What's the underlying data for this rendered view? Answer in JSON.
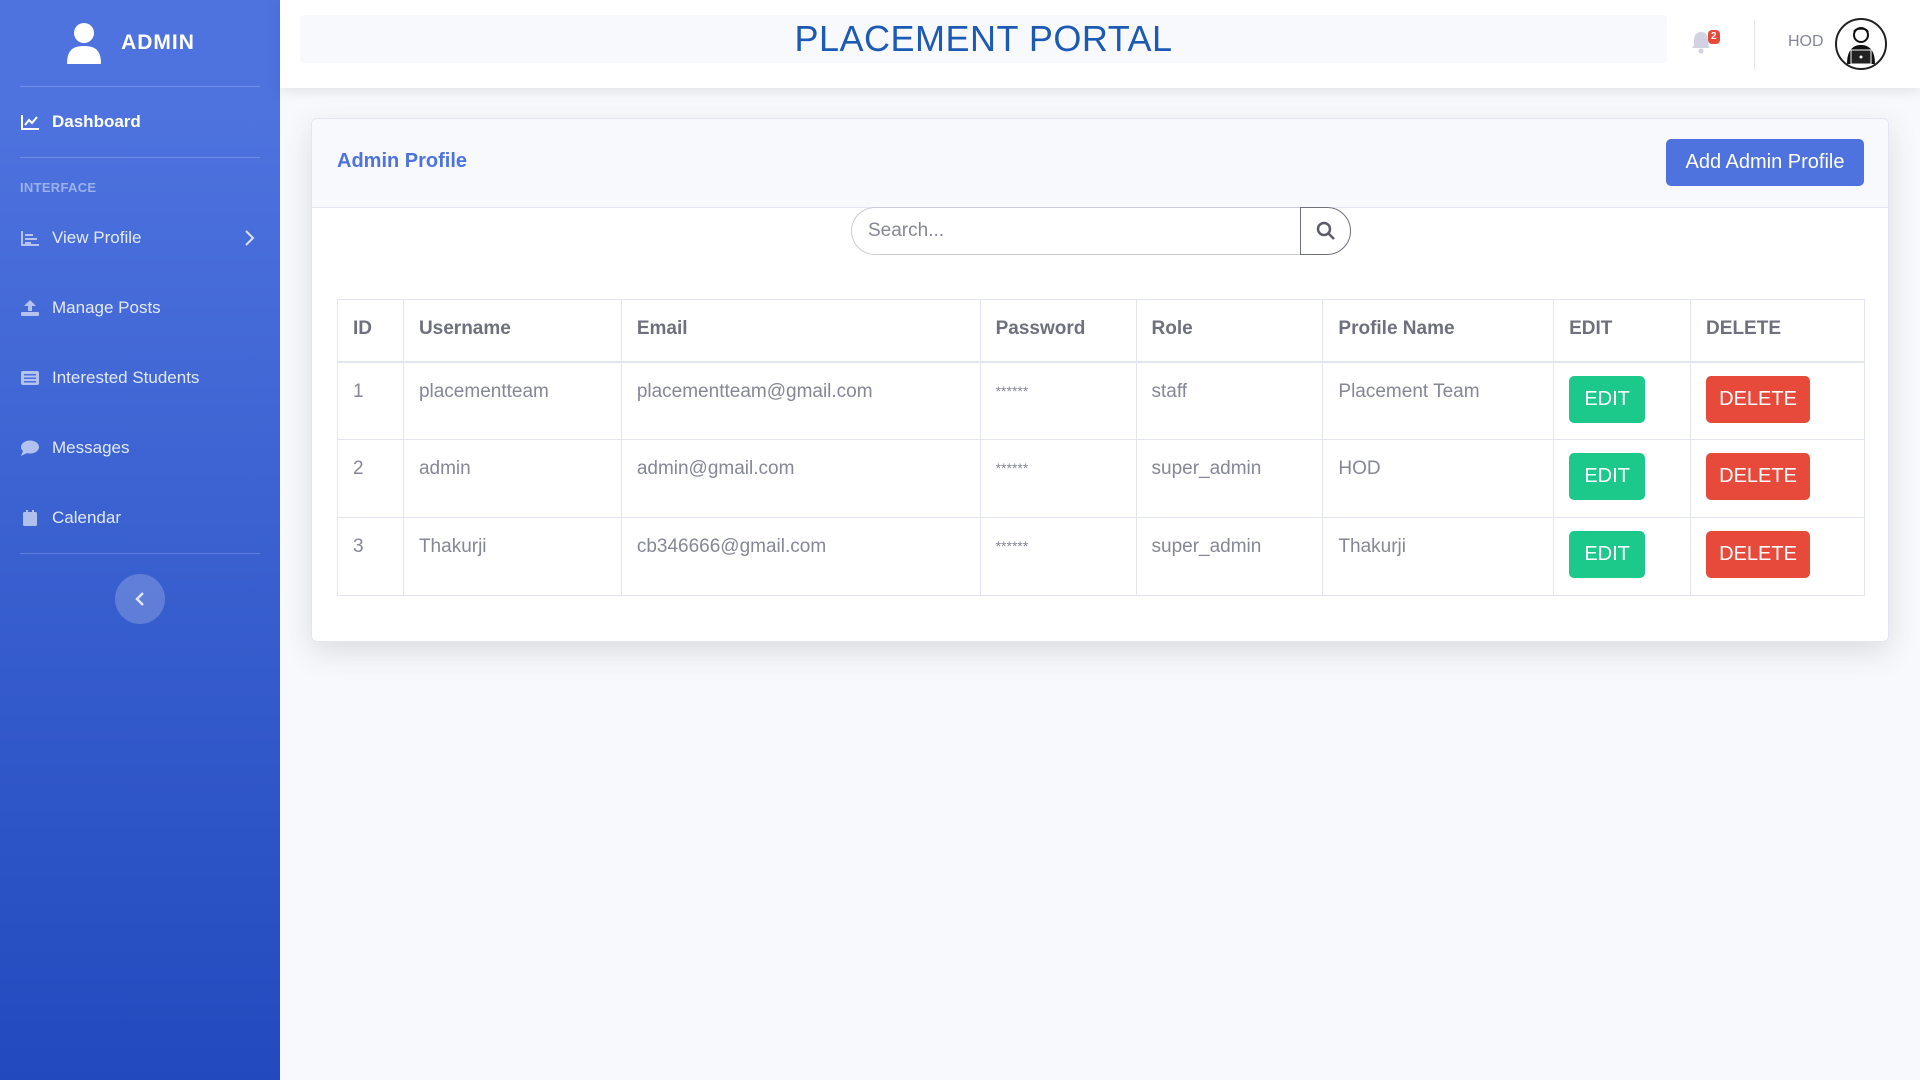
{
  "sidebar": {
    "brand": "ADMIN",
    "dashboard": "Dashboard",
    "section_heading": "INTERFACE",
    "items": [
      {
        "label": "View Profile",
        "icon": "chart-bar-icon"
      },
      {
        "label": "Manage Posts",
        "icon": "upload-icon"
      },
      {
        "label": "Interested Students",
        "icon": "list-icon"
      },
      {
        "label": "Messages",
        "icon": "comment-icon"
      },
      {
        "label": "Calendar",
        "icon": "calendar-icon"
      }
    ]
  },
  "topbar": {
    "title": "PLACEMENT PORTAL",
    "notification_count": "2",
    "user_name": "HOD"
  },
  "card": {
    "title": "Admin Profile",
    "add_button": "Add Admin Profile",
    "search_placeholder": "Search..."
  },
  "table": {
    "headers": [
      "ID",
      "Username",
      "Email",
      "Password",
      "Role",
      "Profile Name",
      "EDIT",
      "DELETE"
    ],
    "rows": [
      {
        "id": "1",
        "username": "placementteam",
        "email": "placementteam@gmail.com",
        "password": "******",
        "role": "staff",
        "profile_name": "Placement Team",
        "edit": "EDIT",
        "delete": "DELETE"
      },
      {
        "id": "2",
        "username": "admin",
        "email": "admin@gmail.com",
        "password": "******",
        "role": "super_admin",
        "profile_name": "HOD",
        "edit": "EDIT",
        "delete": "DELETE"
      },
      {
        "id": "3",
        "username": "Thakurji",
        "email": "cb346666@gmail.com",
        "password": "******",
        "role": "super_admin",
        "profile_name": "Thakurji",
        "edit": "EDIT",
        "delete": "DELETE"
      }
    ]
  },
  "colors": {
    "primary": "#4e73df",
    "success": "#1cc88a",
    "danger": "#e74a3b",
    "title": "#1d5ab4"
  }
}
